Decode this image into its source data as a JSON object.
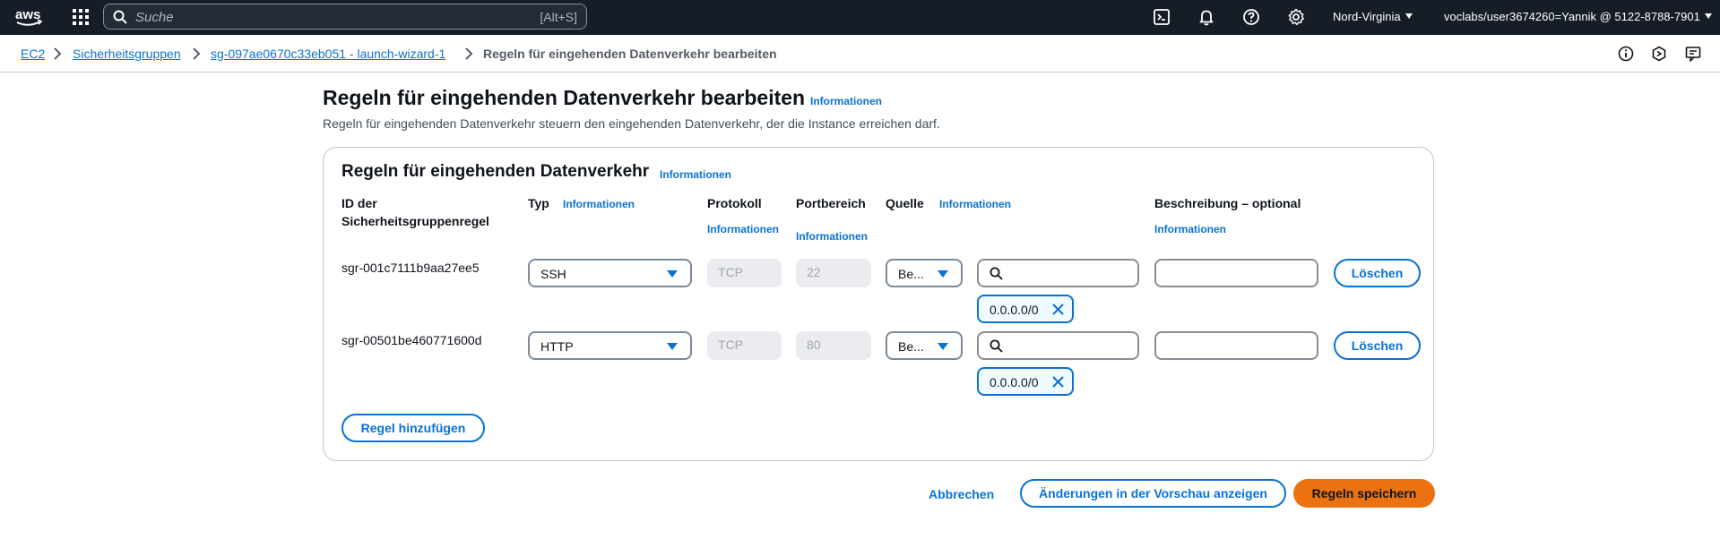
{
  "topnav": {
    "logo_text": "aws",
    "search_placeholder": "Suche",
    "search_shortcut": "[Alt+S]",
    "region": "Nord-Virginia",
    "account": "voclabs/user3674260=Yannik @ 5122-8788-7901"
  },
  "breadcrumb": {
    "items": [
      "EC2",
      "Sicherheitsgruppen",
      "sg-097ae0670c33eb051 - launch-wizard-1"
    ],
    "current": "Regeln für eingehenden Datenverkehr bearbeiten"
  },
  "page": {
    "title": "Regeln für eingehenden Datenverkehr bearbeiten",
    "info": "Informationen",
    "description": "Regeln für eingehenden Datenverkehr steuern den eingehenden Datenverkehr, der die Instance erreichen darf."
  },
  "panel": {
    "title": "Regeln für eingehenden Datenverkehr",
    "info": "Informationen",
    "columns": {
      "rule_id": "ID der Sicherheitsgruppenregel",
      "type": "Typ",
      "protocol": "Protokoll",
      "port_range": "Portbereich",
      "source": "Quelle",
      "description": "Beschreibung – optional",
      "info": "Informationen"
    },
    "rules": [
      {
        "id": "sgr-001c7111b9aa27ee5",
        "type": "SSH",
        "protocol": "TCP",
        "port": "22",
        "source": "Be...",
        "cidr": "0.0.0.0/0",
        "delete": "Löschen"
      },
      {
        "id": "sgr-00501be460771600d",
        "type": "HTTP",
        "protocol": "TCP",
        "port": "80",
        "source": "Be...",
        "cidr": "0.0.0.0/0",
        "delete": "Löschen"
      }
    ],
    "add_rule": "Regel hinzufügen"
  },
  "actions": {
    "cancel": "Abbrechen",
    "preview": "Änderungen in der Vorschau anzeigen",
    "save": "Regeln speichern"
  },
  "colors": {
    "nav_bg": "#161d26",
    "link": "#0972d3",
    "primary": "#ec7211"
  }
}
